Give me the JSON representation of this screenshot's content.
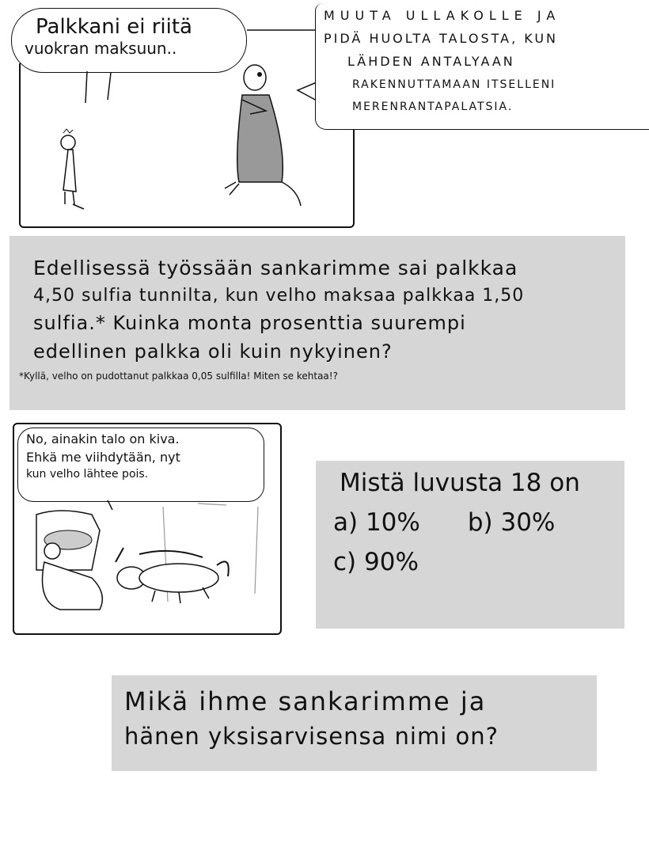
{
  "comic_top": {
    "thought_bubble_lines": [
      "Palkkani ei riitä",
      "vuokran maksuun.."
    ],
    "speech_bubble_lines": [
      "MUUTA ULLAKOLLE JA",
      "PIDÄ HUOLTA TALOSTA, KUN",
      "LÄHDEN ANTALYAAN",
      "RAKENNUTTAMAAN ITSELLENI",
      "MERENRANTAPALATSIA."
    ]
  },
  "task_box_1": {
    "lines": [
      "Edellisessä työssään sankarimme sai palkkaa",
      "4,50 sulfia tunnilta, kun velho maksaa palkkaa 1,50",
      "sulfia.* Kuinka monta prosenttia suurempi",
      "edellinen palkka oli kuin nykyinen?"
    ],
    "footnote": "*Kyllä, velho on pudottanut palkkaa 0,05 sulfilla! Miten se kehtaa!?"
  },
  "comic_bottom": {
    "speech_bubble_lines": [
      "No, ainakin talo on kiva.",
      "Ehkä me viihdytään, nyt",
      "kun velho lähtee pois."
    ]
  },
  "task_box_2": {
    "title": "Mistä luvusta 18 on",
    "options": [
      "a) 10%",
      "b) 30%",
      "c) 90%"
    ]
  },
  "task_box_3": {
    "lines": [
      "Mikä ihme sankarimme ja",
      "hänen yksisarvisensa nimi on?"
    ]
  },
  "colors": {
    "box_gray": "#d6d6d6",
    "ink": "#111111"
  }
}
